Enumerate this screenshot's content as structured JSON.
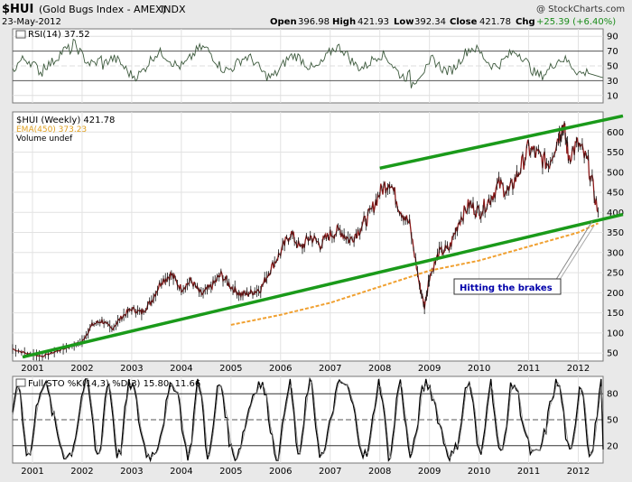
{
  "header": {
    "symbol": "$HUI",
    "index_name": "(Gold Bugs Index - AMEX)",
    "exchange": "INDX",
    "date": "23-May-2012",
    "watermark": "@ StockCharts.com",
    "open_label": "Open",
    "open": "396.98",
    "high_label": "High",
    "high": "421.93",
    "low_label": "Low",
    "low": "392.34",
    "close_label": "Close",
    "close": "421.78",
    "chg_label": "Chg",
    "chg": "+25.39 (+6.40%)",
    "chg_color": "#1a8c1a"
  },
  "rsi_panel": {
    "label": "RSI(14) 37.52",
    "ticks": [
      "90",
      "70",
      "50",
      "30",
      "10"
    ],
    "tick_values": [
      90,
      70,
      50,
      30,
      10
    ],
    "overbought": 70,
    "oversold": 30,
    "line_color": "#3d5a3d"
  },
  "main_panel": {
    "legend": [
      {
        "text": "$HUI (Weekly) 421.78",
        "color": "#000000"
      },
      {
        "text": "EMA(450) 373.23",
        "color": "#e0a020"
      },
      {
        "text": "Volume undef",
        "color": "#000000"
      }
    ],
    "y_ticks": [
      "600",
      "550",
      "500",
      "450",
      "400",
      "350",
      "300",
      "250",
      "200",
      "150",
      "100",
      "50"
    ],
    "y_tick_values": [
      600,
      550,
      500,
      450,
      400,
      350,
      300,
      250,
      200,
      150,
      100,
      50
    ],
    "annotation": "Hitting the brakes",
    "annotation_color": "#0000aa",
    "trendline_color": "#1a9a1a",
    "price_color": "#8b1a1a",
    "ema_color": "#f0a030"
  },
  "sto_panel": {
    "label": "Full STO %K(14,3) %D(3) 15.80, 11.66",
    "ticks": [
      "80",
      "50",
      "20"
    ],
    "tick_values": [
      80,
      50,
      20
    ]
  },
  "x_axis": {
    "labels": [
      "2001",
      "2002",
      "2003",
      "2004",
      "2005",
      "2006",
      "2007",
      "2008",
      "2009",
      "2010",
      "2011",
      "2012"
    ]
  },
  "chart_data": {
    "type": "line",
    "title": "$HUI (Gold Bugs Index - AMEX) INDX",
    "series": [
      {
        "name": "$HUI (Weekly)",
        "x": [
          2000.6,
          2000.9,
          2001.2,
          2001.5,
          2001.8,
          2002.0,
          2002.2,
          2002.4,
          2002.6,
          2002.8,
          2003.0,
          2003.2,
          2003.4,
          2003.6,
          2003.8,
          2004.0,
          2004.2,
          2004.4,
          2004.6,
          2004.8,
          2005.0,
          2005.2,
          2005.4,
          2005.6,
          2005.8,
          2006.0,
          2006.2,
          2006.4,
          2006.6,
          2006.8,
          2007.0,
          2007.2,
          2007.4,
          2007.6,
          2007.8,
          2008.0,
          2008.2,
          2008.4,
          2008.6,
          2008.8,
          2008.9,
          2009.0,
          2009.2,
          2009.4,
          2009.6,
          2009.8,
          2010.0,
          2010.2,
          2010.4,
          2010.6,
          2010.8,
          2011.0,
          2011.2,
          2011.4,
          2011.6,
          2011.7,
          2011.8,
          2012.0,
          2012.2,
          2012.4
        ],
        "values": [
          60,
          48,
          42,
          55,
          68,
          78,
          120,
          130,
          110,
          140,
          160,
          150,
          180,
          230,
          245,
          210,
          230,
          195,
          215,
          245,
          215,
          195,
          200,
          210,
          260,
          300,
          350,
          310,
          340,
          320,
          345,
          355,
          330,
          360,
          395,
          450,
          480,
          410,
          370,
          220,
          165,
          240,
          300,
          310,
          380,
          420,
          400,
          430,
          470,
          450,
          500,
          560,
          540,
          520,
          590,
          620,
          540,
          570,
          520,
          400
        ]
      },
      {
        "name": "EMA(450)",
        "x": [
          2005.0,
          2006.0,
          2007.0,
          2008.0,
          2009.0,
          2010.0,
          2011.0,
          2012.0,
          2012.4
        ],
        "values": [
          120,
          145,
          175,
          215,
          255,
          280,
          315,
          350,
          373
        ]
      }
    ],
    "trendlines": [
      {
        "x": [
          2000.8,
          2012.9
        ],
        "values": [
          40,
          395
        ]
      },
      {
        "x": [
          2008.0,
          2012.9
        ],
        "values": [
          510,
          640
        ]
      }
    ],
    "rsi_last": 37.52,
    "sto_last": [
      15.8,
      11.66
    ],
    "ylim": [
      30,
      650
    ],
    "xlim": [
      2000.6,
      2012.5
    ]
  }
}
